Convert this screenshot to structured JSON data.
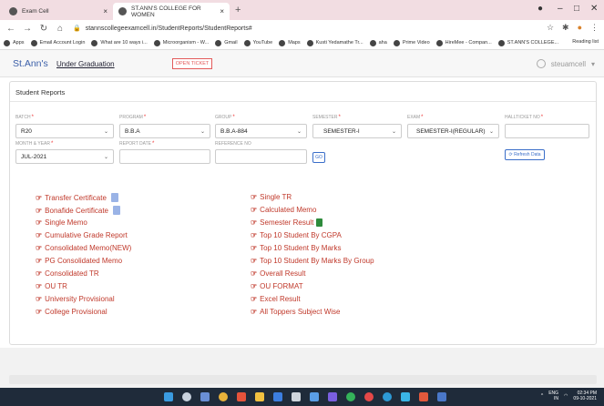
{
  "browser": {
    "tabs": [
      {
        "label": "Exam Cell",
        "active": false
      },
      {
        "label": "ST.ANN'S COLLEGE FOR WOMEN",
        "active": true
      }
    ],
    "url": "stannscollegeexamcell.in/StudentReports/StudentReports#",
    "bookmarks": [
      "Apps",
      "Email Account Login",
      "What are 10 ways i...",
      "Microorganism - W...",
      "Gmail",
      "YouTube",
      "Maps",
      "Kusti Yedamathe Tr...",
      "aha",
      "Prime Video",
      "HireMee - Compan...",
      "ST.ANN'S COLLEGE..."
    ],
    "reading_list": "Reading list",
    "tab_close": "×",
    "new_tab": "+"
  },
  "header": {
    "brand": "St.Ann's",
    "link": "Under Graduation",
    "ticket_button": "OPEN TICKET",
    "user": "steuamcell"
  },
  "card": {
    "title": "Student Reports",
    "filters": {
      "batch": {
        "label": "BATCH",
        "value": "R20"
      },
      "program": {
        "label": "PROGRAM",
        "value": "B.B.A"
      },
      "group": {
        "label": "GROUP",
        "value": "B.B.A-884"
      },
      "semester": {
        "label": "SEMESTER",
        "value": "SEMESTER-I"
      },
      "exam": {
        "label": "EXAM",
        "value": "SEMESTER-I(REGULAR)"
      },
      "hallticket": {
        "label": "HALLTICKET NO",
        "value": ""
      },
      "month_year": {
        "label": "MONTH & YEAR",
        "value": "JUL-2021"
      },
      "report_date": {
        "label": "REPORT DATE",
        "value": ""
      },
      "reference": {
        "label": "REFERENCE NO",
        "value": ""
      },
      "go_button": "GO",
      "refresh_button": "Refresh Data"
    },
    "left_links": [
      "Transfer Certificate",
      "Bonafide Certificate",
      "Single Memo",
      "Cumulative Grade Report",
      "Consolidated Memo(NEW)",
      "PG Consolidated Memo",
      "Consolidated TR",
      "OU TR",
      "University Provisional",
      "College Provisional"
    ],
    "right_links": [
      "Single TR",
      "Calculated Memo",
      "Semester Result",
      "Top 10 Student By CGPA",
      "Top 10 Student By Marks",
      "Top 10 Student By Marks By Group",
      "Overall Result",
      "OU FORMAT",
      "Excel Result",
      "All Toppers Subject Wise"
    ]
  },
  "taskbar": {
    "lang": "ENG",
    "region": "IN",
    "time": "02:34 PM",
    "date": "09-10-2021"
  },
  "colors": {
    "link_red": "#c0392b",
    "brand_blue": "#3a5ea8",
    "taskbar": "#1f2b3a"
  }
}
